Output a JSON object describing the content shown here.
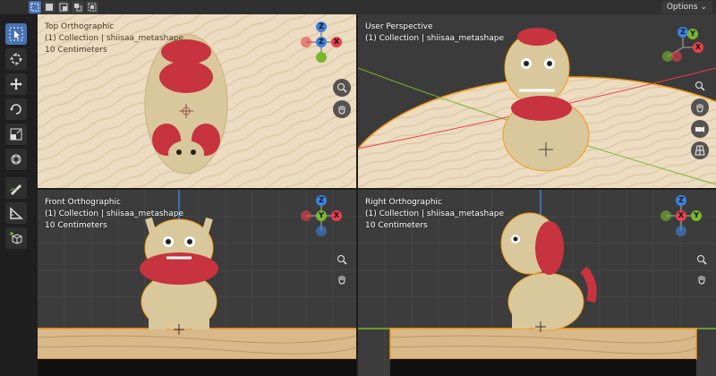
{
  "header": {
    "select_modes": [
      "select-box-icon",
      "select-extend-icon",
      "select-subtract-icon",
      "select-invert-icon",
      "select-intersect-icon"
    ],
    "options_label": "Options"
  },
  "toolbar": {
    "tools": [
      "select-box-icon",
      "cursor-icon",
      "move-icon",
      "rotate-icon",
      "scale-icon",
      "transform-icon",
      "annotate-icon",
      "measure-icon",
      "add-cube-icon"
    ]
  },
  "viewports": {
    "top": {
      "view": "Top Orthographic",
      "collection": "(1) Collection | shiisaa_metashape",
      "scale": "10 Centimeters"
    },
    "user": {
      "view": "User Perspective",
      "collection": "(1) Collection | shiisaa_metashape",
      "scale": ""
    },
    "front": {
      "view": "Front Orthographic",
      "collection": "(1) Collection | shiisaa_metashape",
      "scale": "10 Centimeters"
    },
    "right": {
      "view": "Right Orthographic",
      "collection": "(1) Collection | shiisaa_metashape",
      "scale": "10 Centimeters"
    }
  },
  "gizmo_labels": {
    "x": "X",
    "y": "Y",
    "z": "Z"
  },
  "colors": {
    "accent": "#4772b3",
    "axis_x": "#e6414a",
    "axis_y": "#7ab62d",
    "axis_z": "#3d82e0",
    "selection_outline": "#f29a1d"
  }
}
